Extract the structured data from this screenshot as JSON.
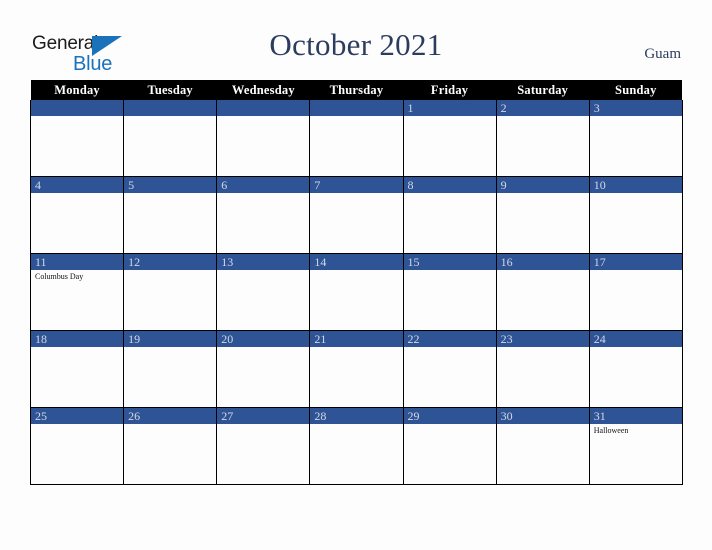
{
  "logo": {
    "word_one": "General",
    "word_two": "Blue",
    "triangle_icon": "triangle-icon",
    "accent_color": "#1a72bb"
  },
  "header": {
    "title": "October 2021",
    "region": "Guam",
    "title_color": "#2c3c5e"
  },
  "calendar": {
    "accent_color": "#2e5496",
    "header_bg": "#000000",
    "weekday_headers": [
      "Monday",
      "Tuesday",
      "Wednesday",
      "Thursday",
      "Friday",
      "Saturday",
      "Sunday"
    ],
    "weeks": [
      [
        {
          "date": "",
          "events": []
        },
        {
          "date": "",
          "events": []
        },
        {
          "date": "",
          "events": []
        },
        {
          "date": "",
          "events": []
        },
        {
          "date": "1",
          "events": []
        },
        {
          "date": "2",
          "events": []
        },
        {
          "date": "3",
          "events": []
        }
      ],
      [
        {
          "date": "4",
          "events": []
        },
        {
          "date": "5",
          "events": []
        },
        {
          "date": "6",
          "events": []
        },
        {
          "date": "7",
          "events": []
        },
        {
          "date": "8",
          "events": []
        },
        {
          "date": "9",
          "events": []
        },
        {
          "date": "10",
          "events": []
        }
      ],
      [
        {
          "date": "11",
          "events": [
            "Columbus Day"
          ]
        },
        {
          "date": "12",
          "events": []
        },
        {
          "date": "13",
          "events": []
        },
        {
          "date": "14",
          "events": []
        },
        {
          "date": "15",
          "events": []
        },
        {
          "date": "16",
          "events": []
        },
        {
          "date": "17",
          "events": []
        }
      ],
      [
        {
          "date": "18",
          "events": []
        },
        {
          "date": "19",
          "events": []
        },
        {
          "date": "20",
          "events": []
        },
        {
          "date": "21",
          "events": []
        },
        {
          "date": "22",
          "events": []
        },
        {
          "date": "23",
          "events": []
        },
        {
          "date": "24",
          "events": []
        }
      ],
      [
        {
          "date": "25",
          "events": []
        },
        {
          "date": "26",
          "events": []
        },
        {
          "date": "27",
          "events": []
        },
        {
          "date": "28",
          "events": []
        },
        {
          "date": "29",
          "events": []
        },
        {
          "date": "30",
          "events": []
        },
        {
          "date": "31",
          "events": [
            "Halloween"
          ]
        }
      ]
    ]
  }
}
